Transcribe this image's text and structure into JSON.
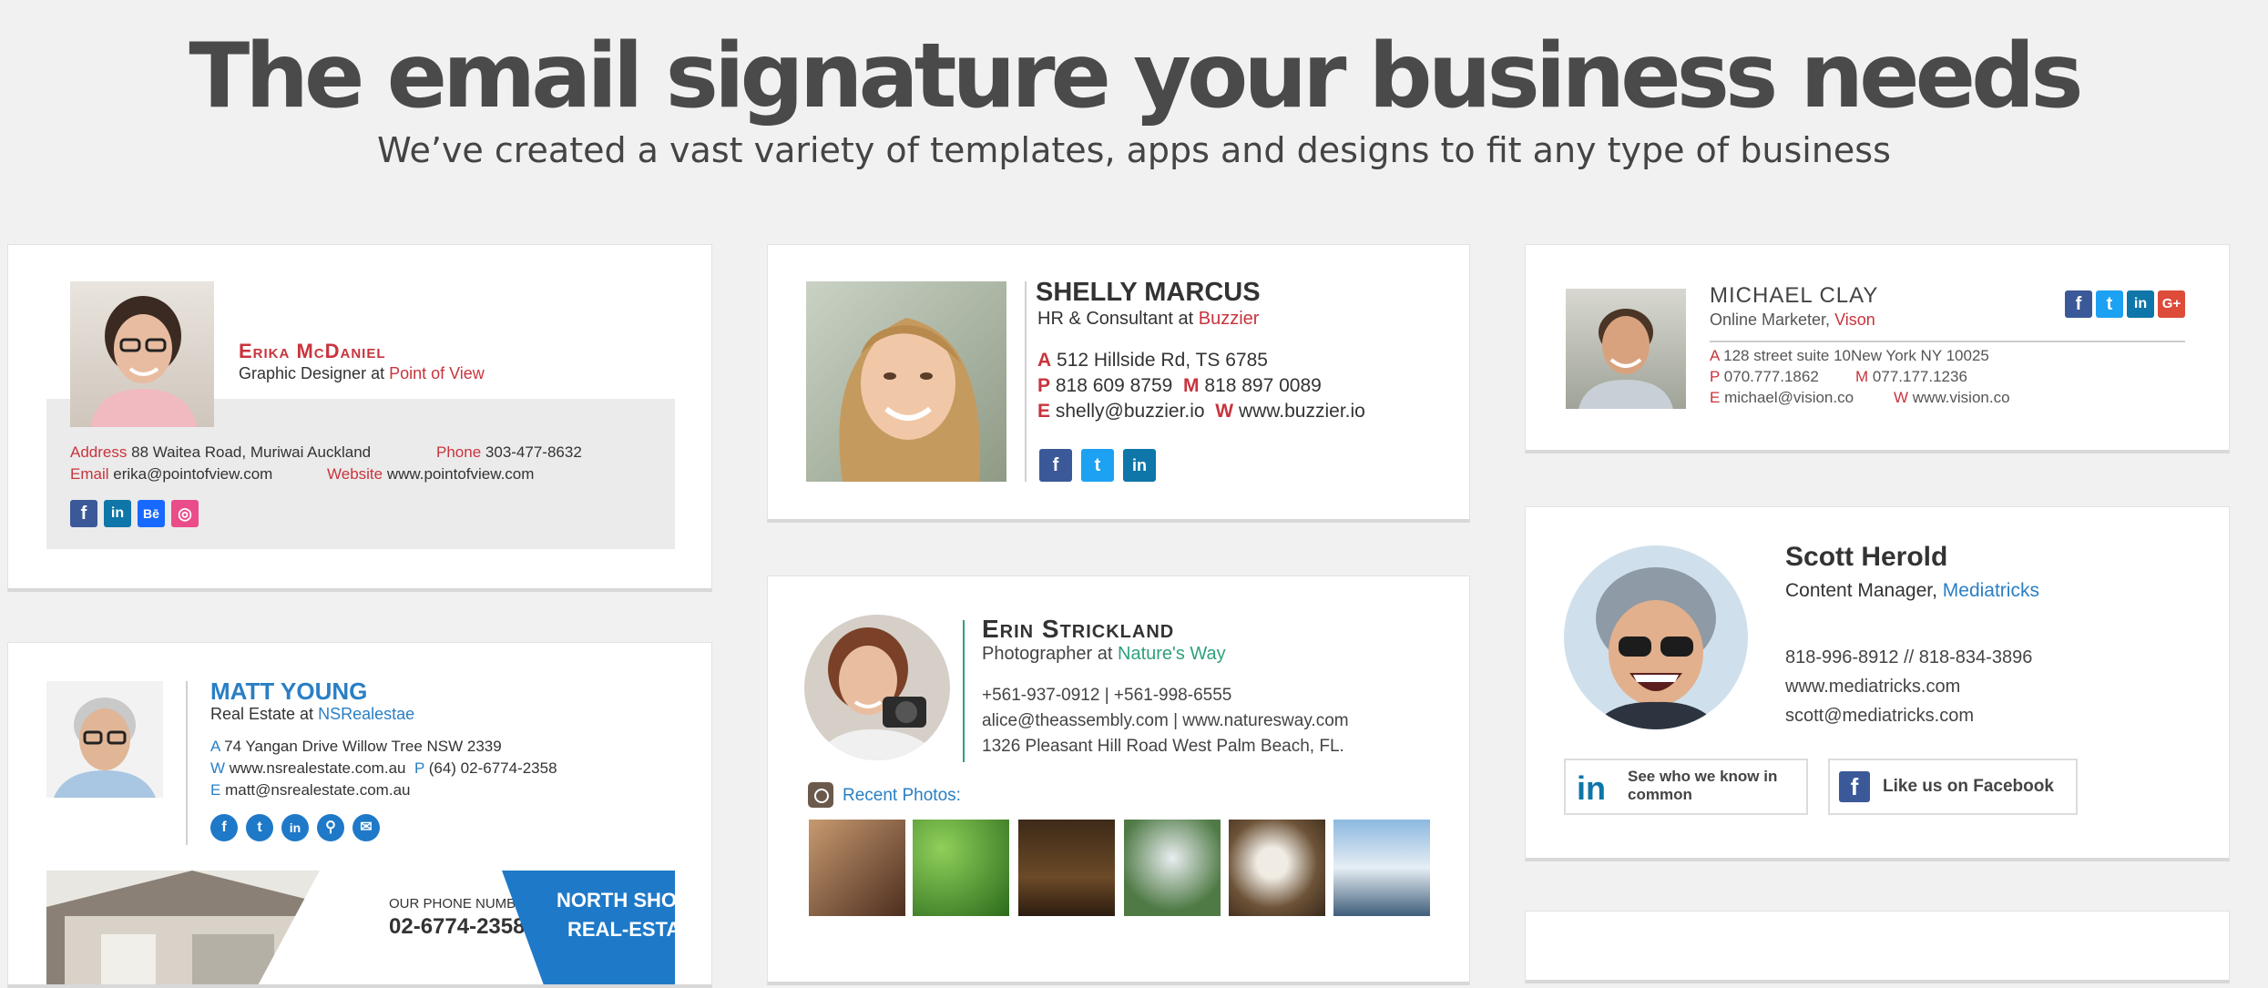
{
  "hero": {
    "title": "The email signature your business needs",
    "subtitle": "We’ve created a vast variety of templates, apps and designs to fit any type of business"
  },
  "colors": {
    "accent_red": "#c8343d",
    "facebook": "#3b5998",
    "twitter": "#1da1f2",
    "linkedin": "#0e76a8",
    "blue_link": "#2a7fc4",
    "green": "#2fa07d"
  },
  "erika": {
    "name": "Erika McDaniel",
    "role_prefix": "Graphic Designer at ",
    "company": "Point of View",
    "address_label": "Address",
    "address": "88 Waitea Road, Muriwai Auckland",
    "phone_label": "Phone",
    "phone": "303-477-8632",
    "email_label": "Email",
    "email": "erika@pointofview.com",
    "website_label": "Website",
    "website": "www.pointofview.com",
    "social": [
      "facebook-icon",
      "linkedin-icon",
      "behance-icon",
      "dribbble-icon"
    ],
    "social_glyphs": [
      "f",
      "in",
      "Bē",
      "◎"
    ]
  },
  "shelly": {
    "name": "SHELLY MARCUS",
    "role_prefix": "HR & Consultant at ",
    "company": "Buzzier",
    "a_label": "A",
    "address": "512 Hillside Rd, TS 6785",
    "p_label": "P",
    "phone": "818 609 8759",
    "m_label": "M",
    "mobile": "818 897 0089",
    "e_label": "E",
    "email": "shelly@buzzier.io",
    "w_label": "W",
    "website": "www.buzzier.io",
    "social_glyphs": [
      "f",
      "t",
      "in"
    ]
  },
  "michael": {
    "name": "MICHAEL CLAY",
    "role_prefix": "Online Marketer, ",
    "company": "Vison",
    "a_label": "A",
    "address": "128 street suite 10New York NY 10025",
    "p_label": "P",
    "phone": "070.777.1862",
    "m_label": "M",
    "mobile": "077.177.1236",
    "e_label": "E",
    "email": "michael@vision.co",
    "w_label": "W",
    "website": "www.vision.co",
    "social_glyphs": [
      "f",
      "t",
      "in",
      "G+"
    ]
  },
  "scott": {
    "name": "Scott Herold",
    "role_prefix": "Content Manager, ",
    "company": "Mediatricks",
    "phones": "818-996-8912 //  818-834-3896",
    "website": "www.mediatricks.com",
    "email": "scott@mediatricks.com",
    "linkedin_glyph": "in",
    "linkedin_btn": "See who we know in common",
    "facebook_glyph": "f",
    "facebook_btn": "Like us on Facebook"
  },
  "matt": {
    "name": "MATT YOUNG",
    "role_prefix": "Real Estate at ",
    "company": "NSRealestae",
    "a_label": "A",
    "address": "74 Yangan Drive Willow Tree NSW 2339",
    "w_label": "W",
    "website": "www.nsrealestate.com.au",
    "p_label": "P",
    "phone": "(64) 02-6774-2358",
    "e_label": "E",
    "email": "matt@nsrealestate.com.au",
    "social_glyphs": [
      "f",
      "t",
      "in",
      "⚲",
      "✉"
    ],
    "banner_phone_label": "OUR PHONE NUMBER",
    "banner_phone": "02-6774-2358",
    "banner_line1": "NORTH SHORE",
    "banner_line2": "REAL-ESTATE"
  },
  "erin": {
    "name": "Erin Strickland",
    "role_prefix": "Photographer at ",
    "company": "Nature's Way",
    "phones": "+561-937-0912 | +561-998-6555",
    "emails": "alice@theassembly.com | www.naturesway.com",
    "address": "1326 Pleasant Hill Road West Palm Beach, FL.",
    "recent_photos": "Recent Photos:"
  }
}
